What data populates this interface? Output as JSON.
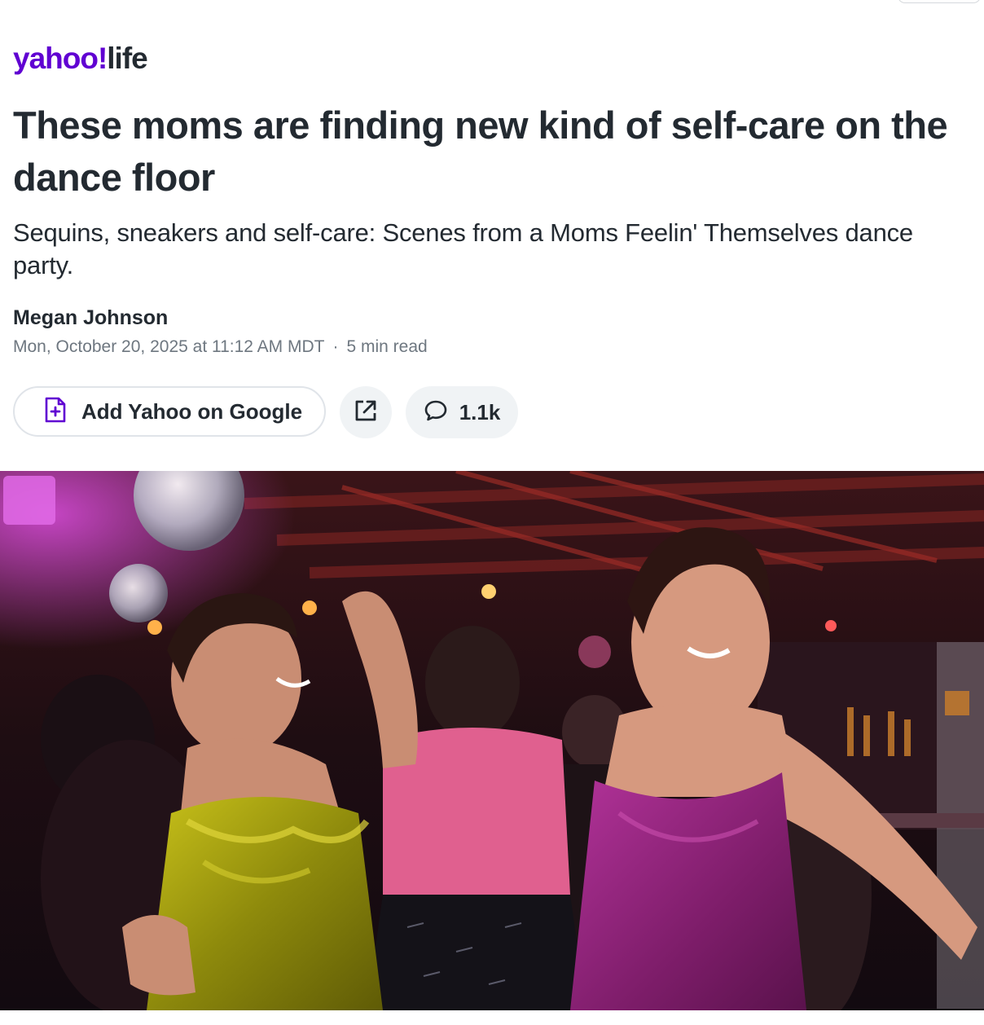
{
  "site": {
    "brand": "yahoo!",
    "section": "life"
  },
  "article": {
    "headline": "These moms are finding new kind of self-care on the dance floor",
    "subheadline": "Sequins, sneakers and self-care: Scenes from a Moms Feelin' Themselves dance party.",
    "author": "Megan Johnson",
    "date": "Mon, October 20, 2025 at 11:12 AM MDT",
    "separator": "·",
    "read_time": "5 min read"
  },
  "actions": {
    "add_google_label": "Add Yahoo on Google",
    "comment_count": "1.1k"
  },
  "icons": {
    "add_google": "add-doc-icon",
    "share": "share-external-icon",
    "comments": "comment-bubble-icon"
  },
  "colors": {
    "brand_purple": "#6001d2",
    "text_dark": "#232a31",
    "text_meta": "#6e7780",
    "button_bg": "#f0f3f5"
  }
}
